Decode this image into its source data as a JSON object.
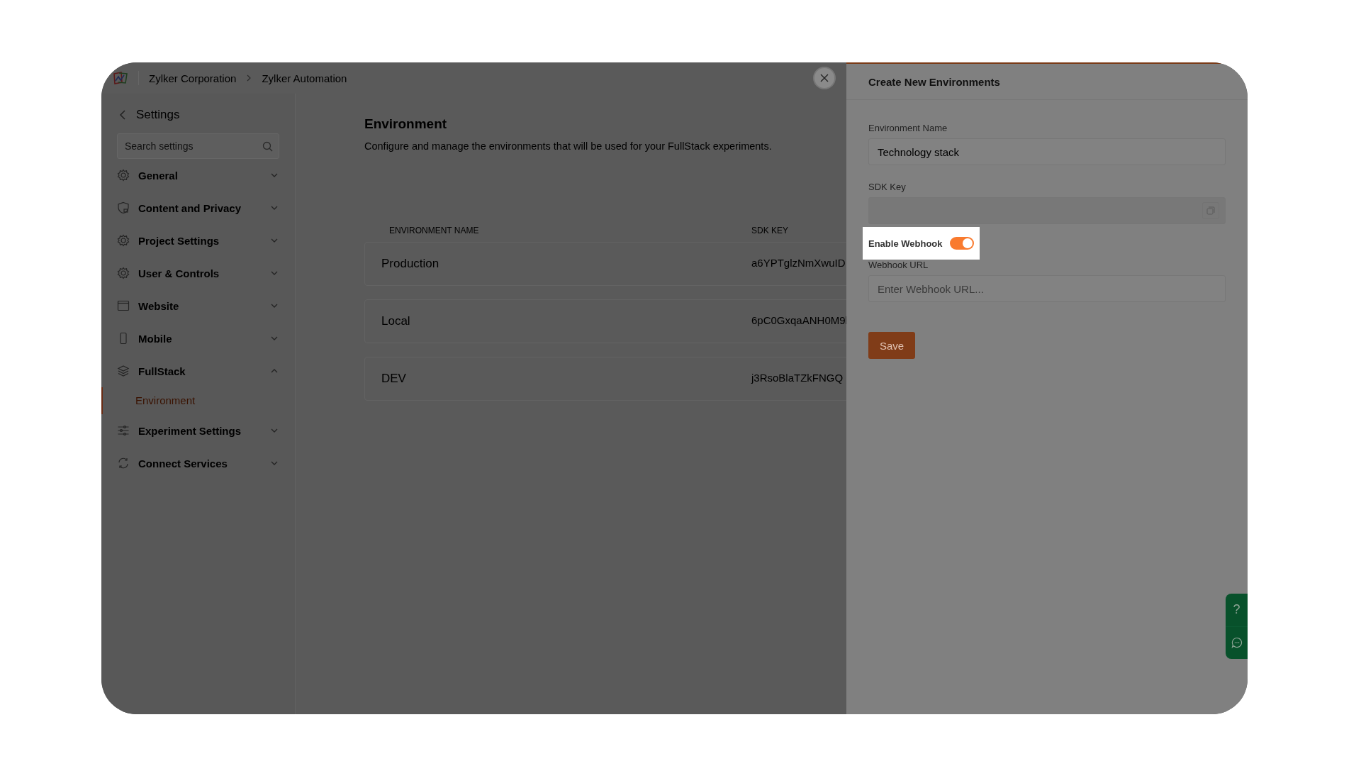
{
  "breadcrumb": [
    "Zylker Corporation",
    "Zylker Automation"
  ],
  "sidebar": {
    "title": "Settings",
    "search": {
      "placeholder": "Search settings"
    },
    "items": [
      {
        "label": "General",
        "expanded": false
      },
      {
        "label": "Content and Privacy",
        "expanded": false
      },
      {
        "label": "Project Settings",
        "expanded": false
      },
      {
        "label": "User & Controls",
        "expanded": false
      },
      {
        "label": "Website",
        "expanded": false
      },
      {
        "label": "Mobile",
        "expanded": false
      },
      {
        "label": "FullStack",
        "expanded": true,
        "children": [
          {
            "label": "Environment",
            "selected": true
          }
        ]
      },
      {
        "label": "Experiment Settings",
        "expanded": false
      },
      {
        "label": "Connect Services",
        "expanded": false
      }
    ]
  },
  "page": {
    "title": "Environment",
    "description": "Configure and manage the environments that will be used for your FullStack experiments."
  },
  "table": {
    "columns": [
      "ENVIRONMENT NAME",
      "SDK KEY"
    ],
    "rows": [
      {
        "name": "Production",
        "sdk_key": "a6YPTglzNmXwuID"
      },
      {
        "name": "Local",
        "sdk_key": "6pC0GxqaANH0M9l"
      },
      {
        "name": "DEV",
        "sdk_key": "j3RsoBlaTZkFNGQ"
      }
    ]
  },
  "panel": {
    "title": "Create New Environments",
    "name_field": {
      "label": "Environment Name",
      "value": "Technology stack"
    },
    "sdk_field": {
      "label": "SDK Key"
    },
    "webhook_toggle": {
      "label": "Enable Webhook",
      "on": true
    },
    "url_field": {
      "label": "Webhook URL",
      "placeholder": "Enter Webhook URL..."
    },
    "save": "Save"
  },
  "help_tab": {
    "question": "?"
  }
}
